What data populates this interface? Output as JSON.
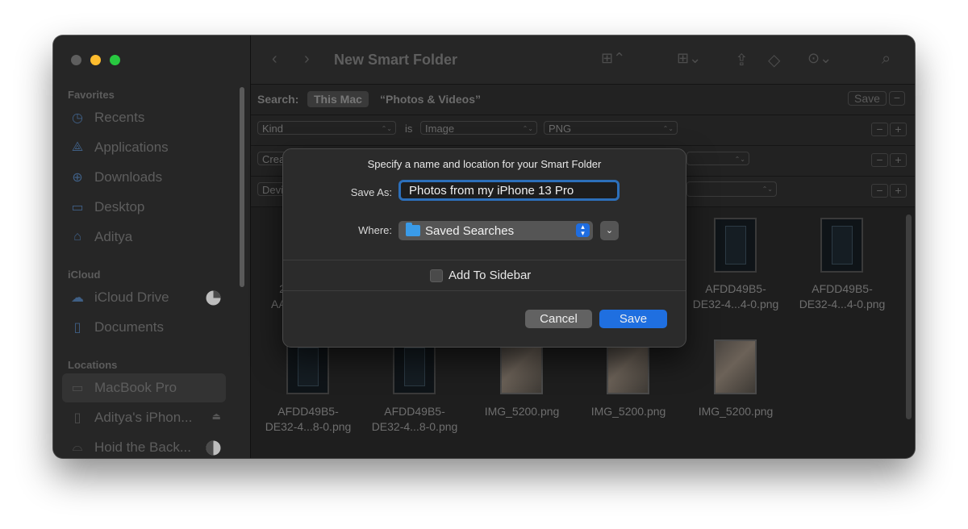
{
  "window": {
    "title": "New Smart Folder"
  },
  "sidebar": {
    "sections": {
      "favorites": "Favorites",
      "icloud": "iCloud",
      "locations": "Locations"
    },
    "favorites": [
      {
        "label": "Recents",
        "icon": "clock-icon"
      },
      {
        "label": "Applications",
        "icon": "applications-icon"
      },
      {
        "label": "Downloads",
        "icon": "downloads-icon"
      },
      {
        "label": "Desktop",
        "icon": "desktop-icon"
      },
      {
        "label": "Aditya",
        "icon": "home-icon"
      }
    ],
    "icloud": [
      {
        "label": "iCloud Drive",
        "icon": "cloud-icon"
      },
      {
        "label": "Documents",
        "icon": "document-icon"
      }
    ],
    "locations": [
      {
        "label": "MacBook Pro",
        "icon": "laptop-icon",
        "selected": true
      },
      {
        "label": "Aditya's iPhon...",
        "icon": "iphone-icon"
      },
      {
        "label": "Hoid the Back...",
        "icon": "drive-icon"
      }
    ]
  },
  "search_bar": {
    "label": "Search:",
    "scope_selected": "This Mac",
    "scope_other": "“Photos & Videos”",
    "save_label": "Save",
    "remove_label": "−"
  },
  "criteria": [
    {
      "attribute": "Kind",
      "operator": "is",
      "value": "Image",
      "subvalue": "PNG"
    },
    {
      "attribute": "Crea"
    },
    {
      "attribute": "Devi"
    }
  ],
  "grid": {
    "row1": [
      {
        "caption_line1": "2",
        "caption_line2": "AAE"
      },
      {
        "caption_line1": "AFDD49B5-",
        "caption_line2": "DE32-4...4-0.png"
      },
      {
        "caption_line1": "AFDD49B5-",
        "caption_line2": "DE32-4...4-0.png"
      }
    ],
    "row2": [
      {
        "caption_line1": "AFDD49B5-",
        "caption_line2": "DE32-4...8-0.png"
      },
      {
        "caption_line1": "AFDD49B5-",
        "caption_line2": "DE32-4...8-0.png"
      },
      {
        "caption_line1": "IMG_5200.png",
        "caption_line2": ""
      },
      {
        "caption_line1": "IMG_5200.png",
        "caption_line2": ""
      },
      {
        "caption_line1": "IMG_5200.png",
        "caption_line2": ""
      }
    ]
  },
  "dialog": {
    "title": "Specify a name and location for your Smart Folder",
    "save_as_label": "Save As:",
    "save_as_value": "Photos from my iPhone 13 Pro",
    "where_label": "Where:",
    "where_value": "Saved Searches",
    "add_to_sidebar_label": "Add To Sidebar",
    "add_to_sidebar_checked": false,
    "cancel_label": "Cancel",
    "save_label": "Save"
  },
  "colors": {
    "accent": "#1f6fe0",
    "focus_ring": "#2c6fba",
    "traffic_red": "#5e5e5e",
    "traffic_yellow": "#febc2e",
    "traffic_green": "#28c840"
  }
}
